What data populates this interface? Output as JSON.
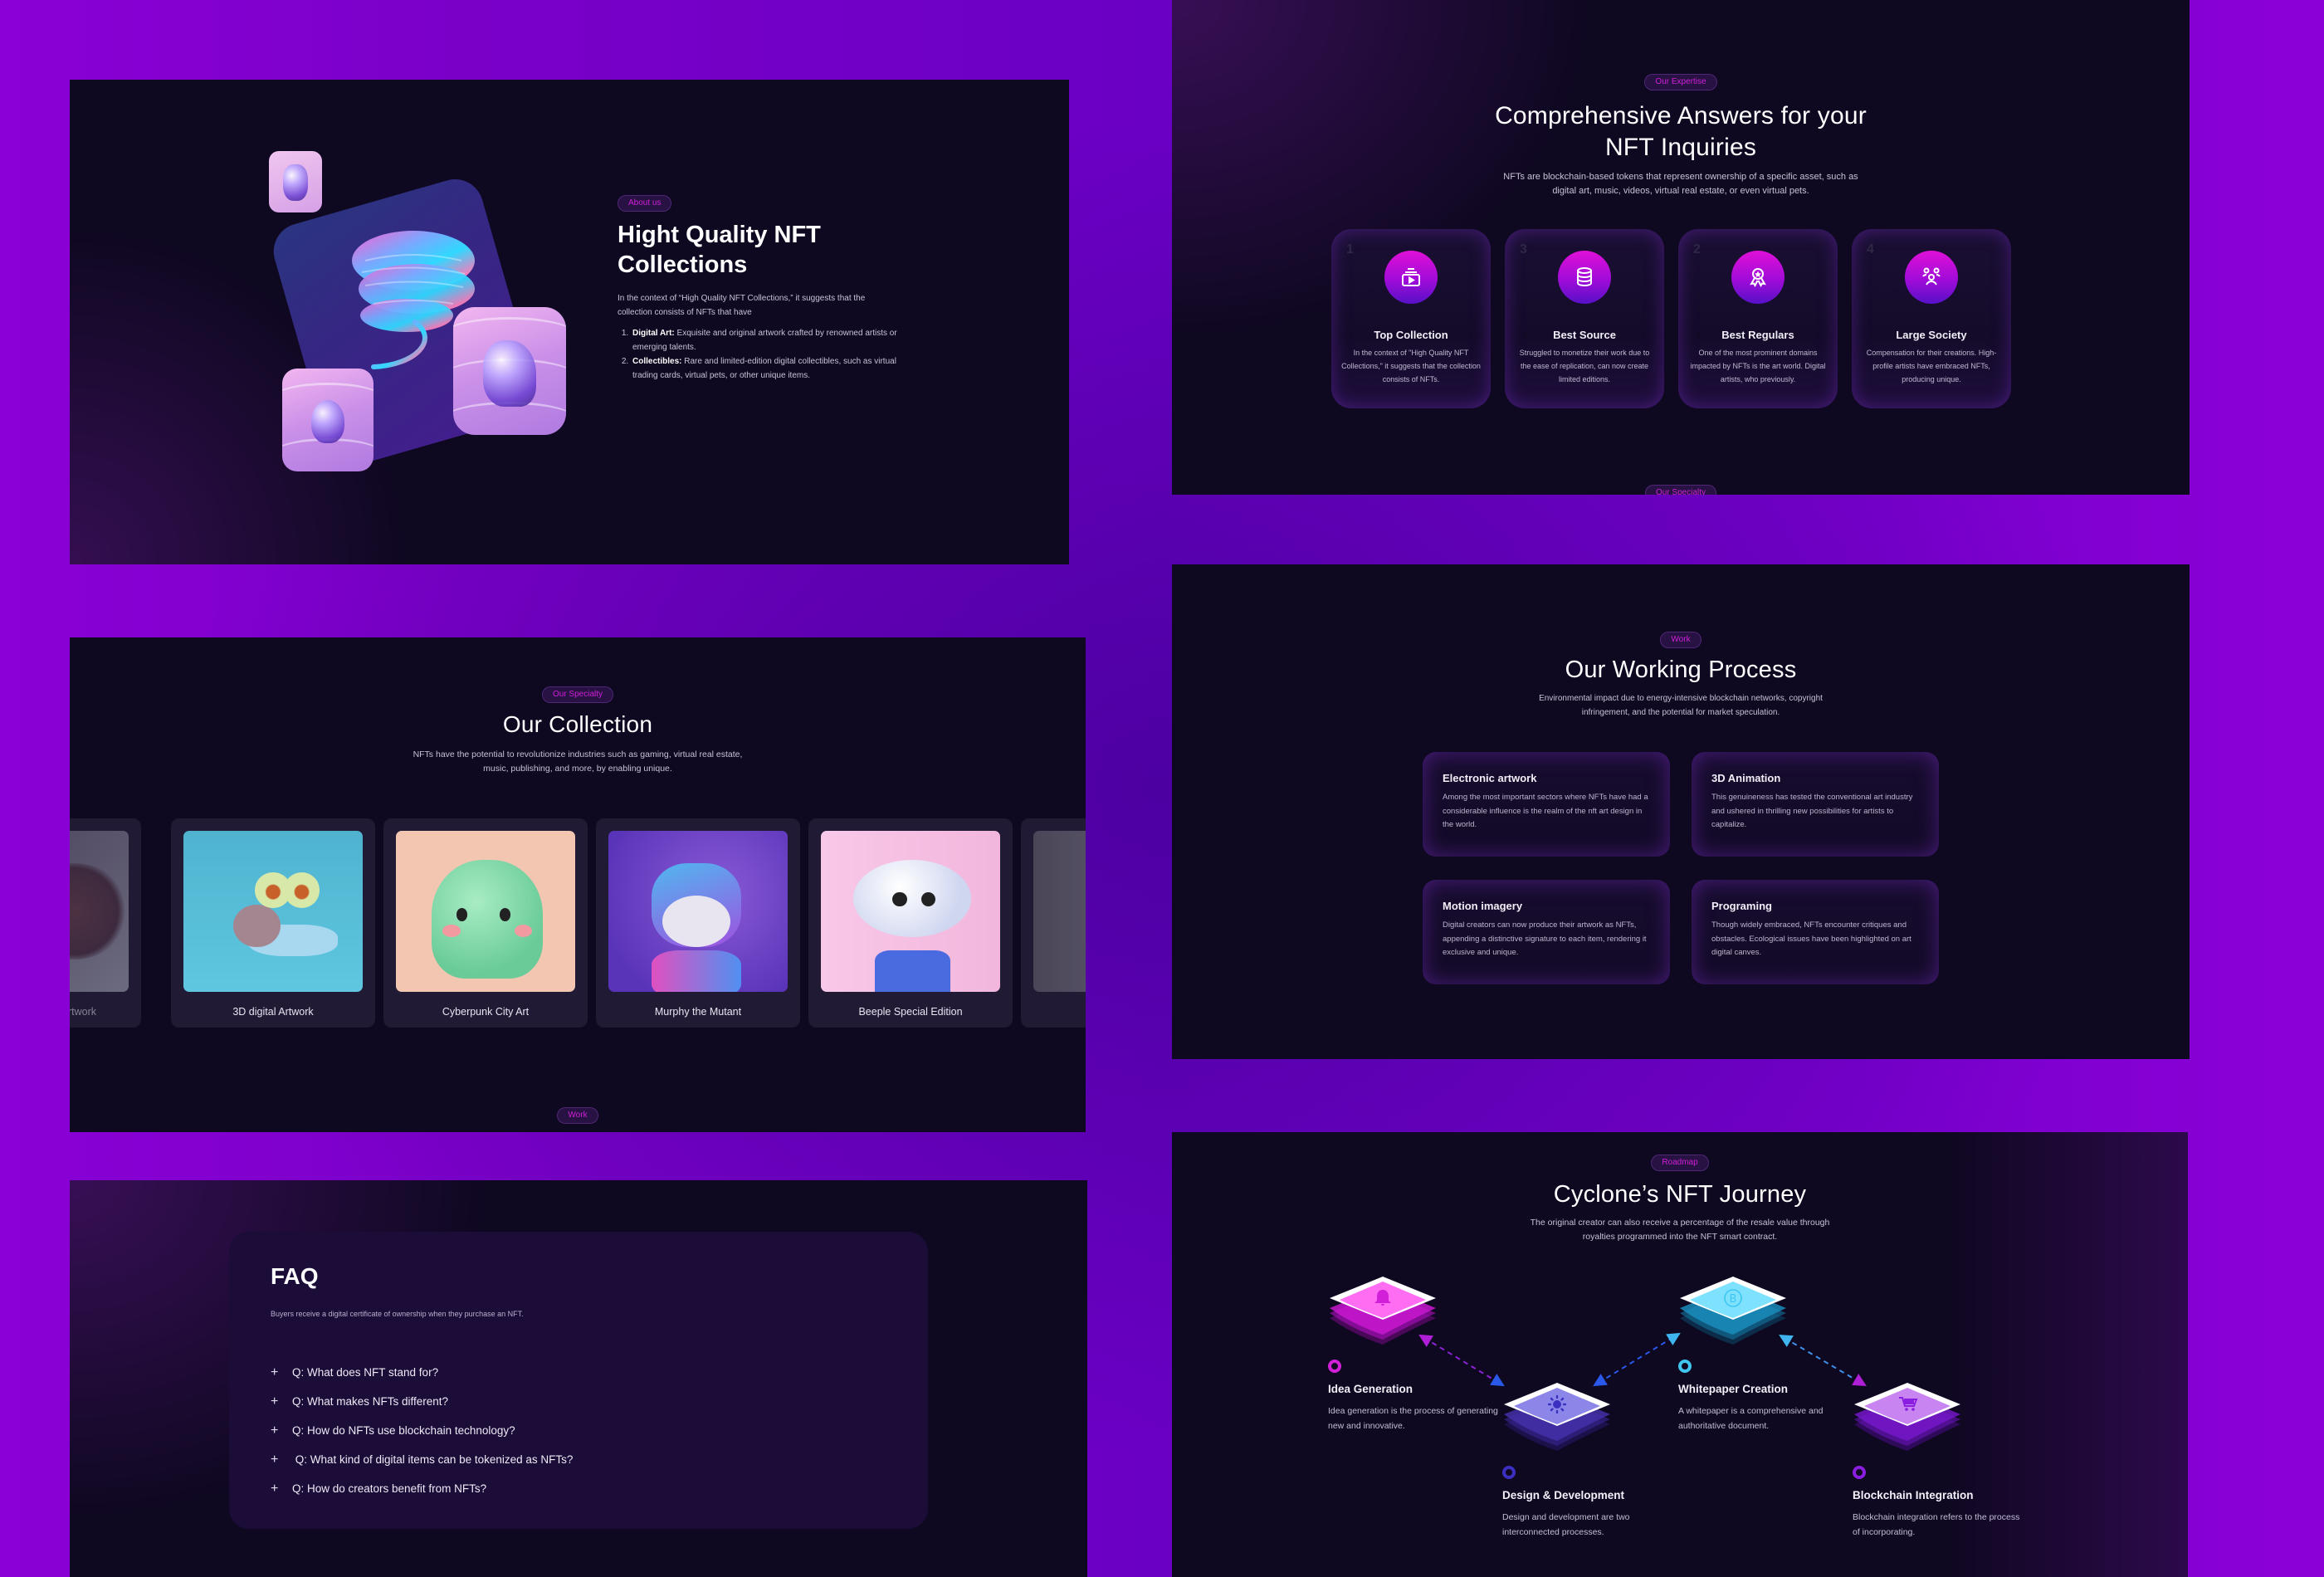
{
  "colors": {
    "page_bg": "#7a00cc",
    "panel_bg": "#0e0820",
    "accent_pink": "#d21fd8",
    "accent_cyan": "#3fc6ef",
    "accent_violet": "#7a2ee0",
    "accent_blue": "#3b2fc0"
  },
  "about": {
    "tag": "About us",
    "title": "Hight Quality NFT Collections",
    "description": "In the context of “High Quality NFT Collections,” it suggests that the collection consists of NFTs that have",
    "list": [
      {
        "term": "Digital Art:",
        "text": " Exquisite and original artwork crafted by renowned artists or emerging talents."
      },
      {
        "term": "Collectibles:",
        "text": " Rare and limited-edition digital collectibles, such as virtual trading cards, virtual pets, or other unique items."
      }
    ]
  },
  "expertise": {
    "tag": "Our Expertise",
    "title_line1": "Comprehensive Answers for your",
    "title_line2": "NFT Inquiries",
    "subtitle": "NFTs are blockchain-based tokens that represent ownership of a specific asset, such as digital art, music, videos, virtual real estate, or even virtual pets.",
    "cards": [
      {
        "number": "1",
        "icon": "video-play-icon",
        "title": "Top Collection",
        "text": "In the context of \"High Quality NFT Collections,\" it suggests that the collection consists of NFTs."
      },
      {
        "number": "3",
        "icon": "database-icon",
        "title": "Best Source",
        "text": "Struggled to monetize their work due to the ease of replication, can now create limited editions."
      },
      {
        "number": "2",
        "icon": "award-medal-icon",
        "title": "Best Regulars",
        "text": "One of the most prominent domains impacted by NFTs is the art world. Digital artists, who previously."
      },
      {
        "number": "4",
        "icon": "community-people-icon",
        "title": "Large Society",
        "text": "Compensation for their creations. High-profile artists have embraced NFTs, producing unique."
      }
    ],
    "next_tag": "Our Specialty"
  },
  "collection": {
    "tag": "Our Specialty",
    "title": "Our Collection",
    "subtitle": "NFTs have the potential to revolutionize industries such as gaming, virtual real estate, music, publishing, and more, by enabling unique.",
    "items": [
      {
        "label": "rtwork",
        "art": "octopus-artwork"
      },
      {
        "label": "3D digital Artwork",
        "art": "snail-character"
      },
      {
        "label": "Cyberpunk City Art",
        "art": "green-creature"
      },
      {
        "label": "Murphy the Mutant",
        "art": "husky-character"
      },
      {
        "label": "Beeple Special Edition",
        "art": "cloud-character"
      },
      {
        "label": "",
        "art": "partial-card"
      }
    ],
    "next_tag": "Work"
  },
  "faq": {
    "title": "FAQ",
    "subtitle": "Buyers receive a digital certificate of ownership when they purchase an NFT.",
    "questions": [
      "Q: What does NFT stand for?",
      "Q: What makes NFTs different?",
      "Q: How do NFTs use blockchain technology?",
      " Q: What kind of digital items can be tokenized as NFTs?",
      "Q: How do creators benefit from NFTs?"
    ],
    "expand_symbol": "+"
  },
  "work": {
    "tag": "Work",
    "title": "Our Working Process",
    "subtitle": "Environmental impact due to energy-intensive blockchain networks, copyright infringement, and the potential for market speculation.",
    "cards": [
      {
        "title": "Electronic artwork",
        "text": "Among the most important sectors where NFTs have had a considerable influence is the realm of the nft art design in the world."
      },
      {
        "title": "3D Animation",
        "text": "This genuineness has tested the conventional art industry and ushered in thrilling new possibilities for artists to capitalize."
      },
      {
        "title": "Motion imagery",
        "text": "Digital creators can now produce their artwork as NFTs, appending a distinctive signature to each item, rendering it exclusive and unique."
      },
      {
        "title": "Programing",
        "text": "Though widely embraced, NFTs encounter critiques and obstacles. Ecological issues have been highlighted on art digital canves."
      }
    ]
  },
  "roadmap": {
    "tag": "Roadmap",
    "title": "Cyclone’s NFT Journey",
    "subtitle": "The original creator can also receive a percentage of the resale value through royalties programmed into the NFT smart contract.",
    "steps": [
      {
        "title": "Idea Generation",
        "text": "Idea generation is the process of generating new and innovative.",
        "icon": "bell-icon",
        "color": "#d21fd8"
      },
      {
        "title": "Design & Development",
        "text": "Design and development are two interconnected processes.",
        "icon": "gear-sun-icon",
        "color": "#3b2fc0"
      },
      {
        "title": "Whitepaper Creation",
        "text": "A whitepaper is a comprehensive and authoritative document.",
        "icon": "bitcoin-icon",
        "color": "#3fc6ef"
      },
      {
        "title": "Blockchain Integration",
        "text": "Blockchain integration refers to the process of incorporating.",
        "icon": "cart-icon",
        "color": "#8a1ee0"
      }
    ]
  }
}
